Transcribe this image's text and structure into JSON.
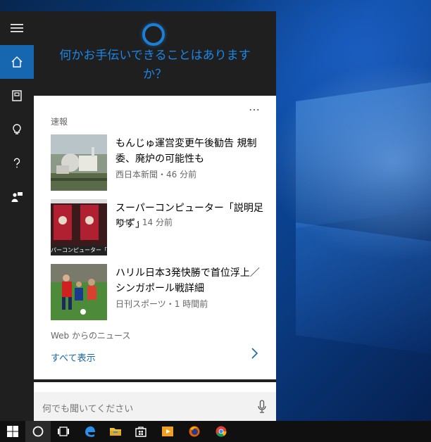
{
  "cortana": {
    "greeting": "何かお手伝いできることはありますか？",
    "more_label": "…",
    "section_title": "速報",
    "news": [
      {
        "title": "もんじゅ運営変更午後勧告 規制委、廃炉の可能性も",
        "meta": "西日本新聞・46 分前"
      },
      {
        "title": "スーパーコンピューター「説明足りず」",
        "meta": "NHK・14 分前",
        "thumb_caption": "パーコンピューター「京」"
      },
      {
        "title": "ハリル日本3発快勝で首位浮上／シンガポール戦詳細",
        "meta": "日刊スポーツ・1 時間前"
      }
    ],
    "web_news_label": "Web からのニュース",
    "show_all_label": "すべて表示",
    "search_placeholder": "何でも聞いてください"
  },
  "sidebar": {
    "items": [
      {
        "icon": "hamburger-menu-icon"
      },
      {
        "icon": "home-icon",
        "active": true
      },
      {
        "icon": "notebook-icon"
      },
      {
        "icon": "reminders-icon"
      },
      {
        "icon": "help-icon"
      },
      {
        "icon": "feedback-icon"
      }
    ]
  },
  "taskbar": {
    "items": [
      "start-icon",
      "cortana-icon",
      "task-view-icon",
      "edge-icon",
      "file-explorer-icon",
      "store-icon",
      "media-player-icon",
      "firefox-icon",
      "chrome-icon"
    ]
  },
  "colors": {
    "accent": "#1666b0",
    "cortana_blue": "#1c86e6",
    "rail": "#1f1f1f"
  }
}
